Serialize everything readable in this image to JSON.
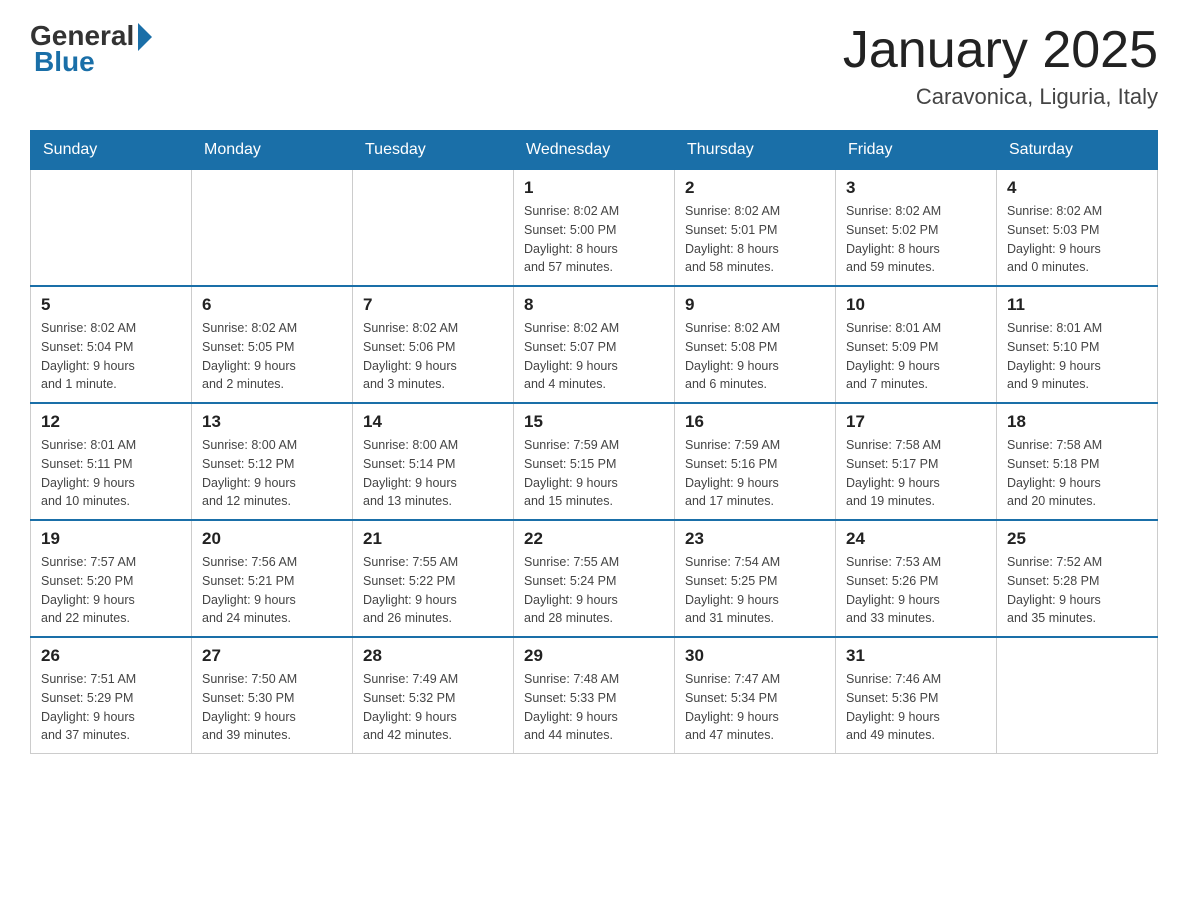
{
  "header": {
    "logo_general": "General",
    "logo_blue": "Blue",
    "title": "January 2025",
    "subtitle": "Caravonica, Liguria, Italy"
  },
  "days_of_week": [
    "Sunday",
    "Monday",
    "Tuesday",
    "Wednesday",
    "Thursday",
    "Friday",
    "Saturday"
  ],
  "weeks": [
    [
      {
        "day": "",
        "info": ""
      },
      {
        "day": "",
        "info": ""
      },
      {
        "day": "",
        "info": ""
      },
      {
        "day": "1",
        "info": "Sunrise: 8:02 AM\nSunset: 5:00 PM\nDaylight: 8 hours\nand 57 minutes."
      },
      {
        "day": "2",
        "info": "Sunrise: 8:02 AM\nSunset: 5:01 PM\nDaylight: 8 hours\nand 58 minutes."
      },
      {
        "day": "3",
        "info": "Sunrise: 8:02 AM\nSunset: 5:02 PM\nDaylight: 8 hours\nand 59 minutes."
      },
      {
        "day": "4",
        "info": "Sunrise: 8:02 AM\nSunset: 5:03 PM\nDaylight: 9 hours\nand 0 minutes."
      }
    ],
    [
      {
        "day": "5",
        "info": "Sunrise: 8:02 AM\nSunset: 5:04 PM\nDaylight: 9 hours\nand 1 minute."
      },
      {
        "day": "6",
        "info": "Sunrise: 8:02 AM\nSunset: 5:05 PM\nDaylight: 9 hours\nand 2 minutes."
      },
      {
        "day": "7",
        "info": "Sunrise: 8:02 AM\nSunset: 5:06 PM\nDaylight: 9 hours\nand 3 minutes."
      },
      {
        "day": "8",
        "info": "Sunrise: 8:02 AM\nSunset: 5:07 PM\nDaylight: 9 hours\nand 4 minutes."
      },
      {
        "day": "9",
        "info": "Sunrise: 8:02 AM\nSunset: 5:08 PM\nDaylight: 9 hours\nand 6 minutes."
      },
      {
        "day": "10",
        "info": "Sunrise: 8:01 AM\nSunset: 5:09 PM\nDaylight: 9 hours\nand 7 minutes."
      },
      {
        "day": "11",
        "info": "Sunrise: 8:01 AM\nSunset: 5:10 PM\nDaylight: 9 hours\nand 9 minutes."
      }
    ],
    [
      {
        "day": "12",
        "info": "Sunrise: 8:01 AM\nSunset: 5:11 PM\nDaylight: 9 hours\nand 10 minutes."
      },
      {
        "day": "13",
        "info": "Sunrise: 8:00 AM\nSunset: 5:12 PM\nDaylight: 9 hours\nand 12 minutes."
      },
      {
        "day": "14",
        "info": "Sunrise: 8:00 AM\nSunset: 5:14 PM\nDaylight: 9 hours\nand 13 minutes."
      },
      {
        "day": "15",
        "info": "Sunrise: 7:59 AM\nSunset: 5:15 PM\nDaylight: 9 hours\nand 15 minutes."
      },
      {
        "day": "16",
        "info": "Sunrise: 7:59 AM\nSunset: 5:16 PM\nDaylight: 9 hours\nand 17 minutes."
      },
      {
        "day": "17",
        "info": "Sunrise: 7:58 AM\nSunset: 5:17 PM\nDaylight: 9 hours\nand 19 minutes."
      },
      {
        "day": "18",
        "info": "Sunrise: 7:58 AM\nSunset: 5:18 PM\nDaylight: 9 hours\nand 20 minutes."
      }
    ],
    [
      {
        "day": "19",
        "info": "Sunrise: 7:57 AM\nSunset: 5:20 PM\nDaylight: 9 hours\nand 22 minutes."
      },
      {
        "day": "20",
        "info": "Sunrise: 7:56 AM\nSunset: 5:21 PM\nDaylight: 9 hours\nand 24 minutes."
      },
      {
        "day": "21",
        "info": "Sunrise: 7:55 AM\nSunset: 5:22 PM\nDaylight: 9 hours\nand 26 minutes."
      },
      {
        "day": "22",
        "info": "Sunrise: 7:55 AM\nSunset: 5:24 PM\nDaylight: 9 hours\nand 28 minutes."
      },
      {
        "day": "23",
        "info": "Sunrise: 7:54 AM\nSunset: 5:25 PM\nDaylight: 9 hours\nand 31 minutes."
      },
      {
        "day": "24",
        "info": "Sunrise: 7:53 AM\nSunset: 5:26 PM\nDaylight: 9 hours\nand 33 minutes."
      },
      {
        "day": "25",
        "info": "Sunrise: 7:52 AM\nSunset: 5:28 PM\nDaylight: 9 hours\nand 35 minutes."
      }
    ],
    [
      {
        "day": "26",
        "info": "Sunrise: 7:51 AM\nSunset: 5:29 PM\nDaylight: 9 hours\nand 37 minutes."
      },
      {
        "day": "27",
        "info": "Sunrise: 7:50 AM\nSunset: 5:30 PM\nDaylight: 9 hours\nand 39 minutes."
      },
      {
        "day": "28",
        "info": "Sunrise: 7:49 AM\nSunset: 5:32 PM\nDaylight: 9 hours\nand 42 minutes."
      },
      {
        "day": "29",
        "info": "Sunrise: 7:48 AM\nSunset: 5:33 PM\nDaylight: 9 hours\nand 44 minutes."
      },
      {
        "day": "30",
        "info": "Sunrise: 7:47 AM\nSunset: 5:34 PM\nDaylight: 9 hours\nand 47 minutes."
      },
      {
        "day": "31",
        "info": "Sunrise: 7:46 AM\nSunset: 5:36 PM\nDaylight: 9 hours\nand 49 minutes."
      },
      {
        "day": "",
        "info": ""
      }
    ]
  ]
}
